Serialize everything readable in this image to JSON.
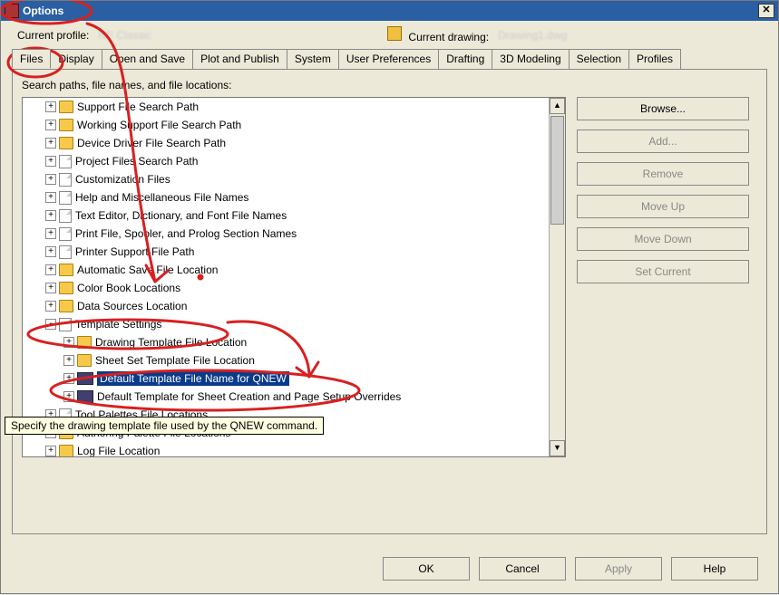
{
  "window": {
    "title": "Options"
  },
  "profile": {
    "label": "Current profile:",
    "value": "NE Classic",
    "drawing_label": "Current drawing:",
    "drawing_value": "Drawing1.dwg"
  },
  "tabs": [
    "Files",
    "Display",
    "Open and Save",
    "Plot and Publish",
    "System",
    "User Preferences",
    "Drafting",
    "3D Modeling",
    "Selection",
    "Profiles"
  ],
  "active_tab": "Files",
  "section_label": "Search paths, file names, and file locations:",
  "tree": [
    {
      "exp": "+",
      "ind": 0,
      "icon": "folder",
      "label": "Support File Search Path"
    },
    {
      "exp": "+",
      "ind": 0,
      "icon": "folder",
      "label": "Working Support File Search Path"
    },
    {
      "exp": "+",
      "ind": 0,
      "icon": "folder",
      "label": "Device Driver File Search Path"
    },
    {
      "exp": "+",
      "ind": 0,
      "icon": "page",
      "label": "Project Files Search Path"
    },
    {
      "exp": "+",
      "ind": 0,
      "icon": "page",
      "label": "Customization Files"
    },
    {
      "exp": "+",
      "ind": 0,
      "icon": "page",
      "label": "Help and Miscellaneous File Names"
    },
    {
      "exp": "+",
      "ind": 0,
      "icon": "page",
      "label": "Text Editor, Dictionary, and Font File Names"
    },
    {
      "exp": "+",
      "ind": 0,
      "icon": "page",
      "label": "Print File, Spooler, and Prolog Section Names"
    },
    {
      "exp": "+",
      "ind": 0,
      "icon": "page",
      "label": "Printer Support File Path"
    },
    {
      "exp": "+",
      "ind": 0,
      "icon": "folder",
      "label": "Automatic Save File Location"
    },
    {
      "exp": "+",
      "ind": 0,
      "icon": "folder",
      "label": "Color Book Locations"
    },
    {
      "exp": "+",
      "ind": 0,
      "icon": "folder",
      "label": "Data Sources Location"
    },
    {
      "exp": "-",
      "ind": 0,
      "icon": "page",
      "label": "Template Settings"
    },
    {
      "exp": "+",
      "ind": 1,
      "icon": "folder",
      "label": "Drawing Template File Location"
    },
    {
      "exp": "+",
      "ind": 1,
      "icon": "folder",
      "label": "Sheet Set Template File Location"
    },
    {
      "exp": "+",
      "ind": 1,
      "icon": "dwg",
      "label": "Default Template File Name for QNEW",
      "selected": true
    },
    {
      "exp": "+",
      "ind": 1,
      "icon": "dwg",
      "label": "Default Template for Sheet Creation and Page Setup Overrides"
    },
    {
      "exp": "+",
      "ind": 0,
      "icon": "page",
      "label": "Tool Palettes File Locations"
    },
    {
      "exp": "+",
      "ind": 0,
      "icon": "folder",
      "label": "Authoring Palette File Locations"
    },
    {
      "exp": "+",
      "ind": 0,
      "icon": "folder",
      "label": "Log File Location"
    }
  ],
  "buttons": {
    "browse": "Browse...",
    "add": "Add...",
    "remove": "Remove",
    "moveup": "Move Up",
    "movedown": "Move Down",
    "setcurrent": "Set Current"
  },
  "bottom": {
    "ok": "OK",
    "cancel": "Cancel",
    "apply": "Apply",
    "help": "Help"
  },
  "tooltip": "Specify the drawing template file used by the QNEW command."
}
